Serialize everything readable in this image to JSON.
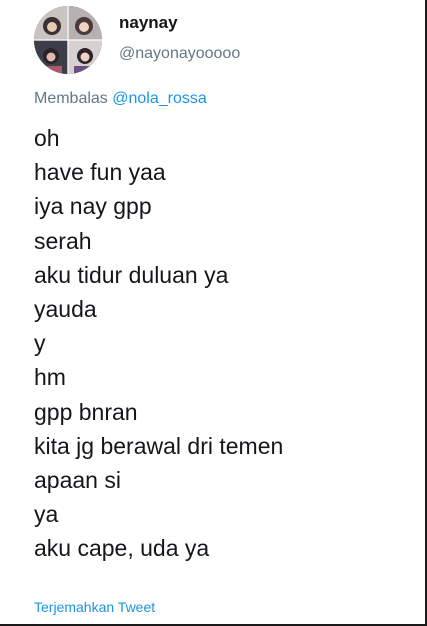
{
  "author": {
    "display_name": "naynay",
    "handle": "@nayonayooooo",
    "avatar_icon": "profile-photo-collage"
  },
  "reply": {
    "prefix": "Membalas ",
    "mention": "@nola_rossa"
  },
  "lines": [
    "oh",
    "have fun yaa",
    "iya nay gpp",
    "serah",
    "aku tidur duluan ya",
    "yauda",
    "y",
    "hm",
    "gpp bnran",
    "kita jg berawal dri temen",
    "apaan si",
    "ya",
    "aku cape, uda ya"
  ],
  "translate_label": "Terjemahkan Tweet",
  "colors": {
    "text": "#14171a",
    "secondary": "#657786",
    "link": "#1b95e0"
  }
}
